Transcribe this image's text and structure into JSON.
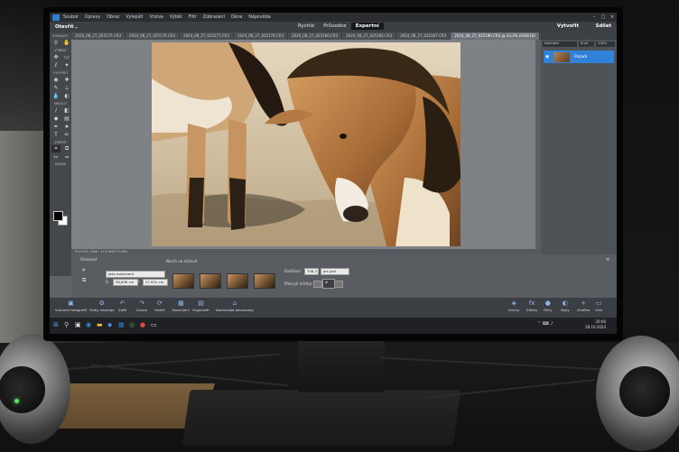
{
  "app": {
    "menu": [
      "Soubor",
      "Úpravy",
      "Obraz",
      "Vylepšit",
      "Vrstva",
      "Výběr",
      "Filtr",
      "Zobrazení",
      "Okna",
      "Nápověda"
    ],
    "open_label": "Otevřít",
    "modes": [
      "Rychlé",
      "Průvodce",
      "Expertní"
    ],
    "active_mode": "Expertní",
    "create_label": "Vytvořit",
    "share_label": "Sdílet"
  },
  "tabs": [
    "2024_08_27_025175.CR3",
    "2024_08_27_025176.CR3",
    "2024_08_27_025177.CR3",
    "2024_08_27_025178.CR3",
    "2024_08_27_025180.CR3",
    "2024_08_27_025185.CR3",
    "2024_08_27_025187.CR3",
    "2024_08_27_025190.CR3 @ 33,3% (RGB/16)"
  ],
  "toolbox": {
    "sections": [
      "ZOBRAZIT",
      "VYBRAT",
      "VYLEPŠIT",
      "KRESLIT",
      "ZMĚNIT",
      "BARVA"
    ]
  },
  "canvas": {
    "status": "33,33%  |  Dok: 115,9M/173,9M"
  },
  "layers": {
    "blend": "Normální",
    "opacity_label": "Krytí",
    "opacity": "100%",
    "layer_name": "Pozadí"
  },
  "options": {
    "tool_name": "Ořezávač",
    "preset_label": "Návrh na ořiznutí",
    "ratio": "Jako dokument",
    "width_label": "Š:",
    "width": "56,896 cm",
    "height_label": "V:",
    "height": "37,931 cm",
    "resolution_label": "Rozlišení:",
    "resolution": "338,3",
    "unit": "pix./pal.",
    "overlay_label": "Překrytí mřížky:"
  },
  "bottombar": {
    "left": [
      "Vrstvení fotografií",
      "Volby nástroje",
      "Zpět",
      "Znovu",
      "Otočit",
      "Rozvržení",
      "Organizér",
      "Domovská obrazovka"
    ],
    "right": [
      "Vrstvy",
      "Efekty",
      "Filtry",
      "Styly",
      "Grafika",
      "Více"
    ]
  },
  "taskbar": {
    "time": "20:06",
    "date": "28.10.2024"
  }
}
